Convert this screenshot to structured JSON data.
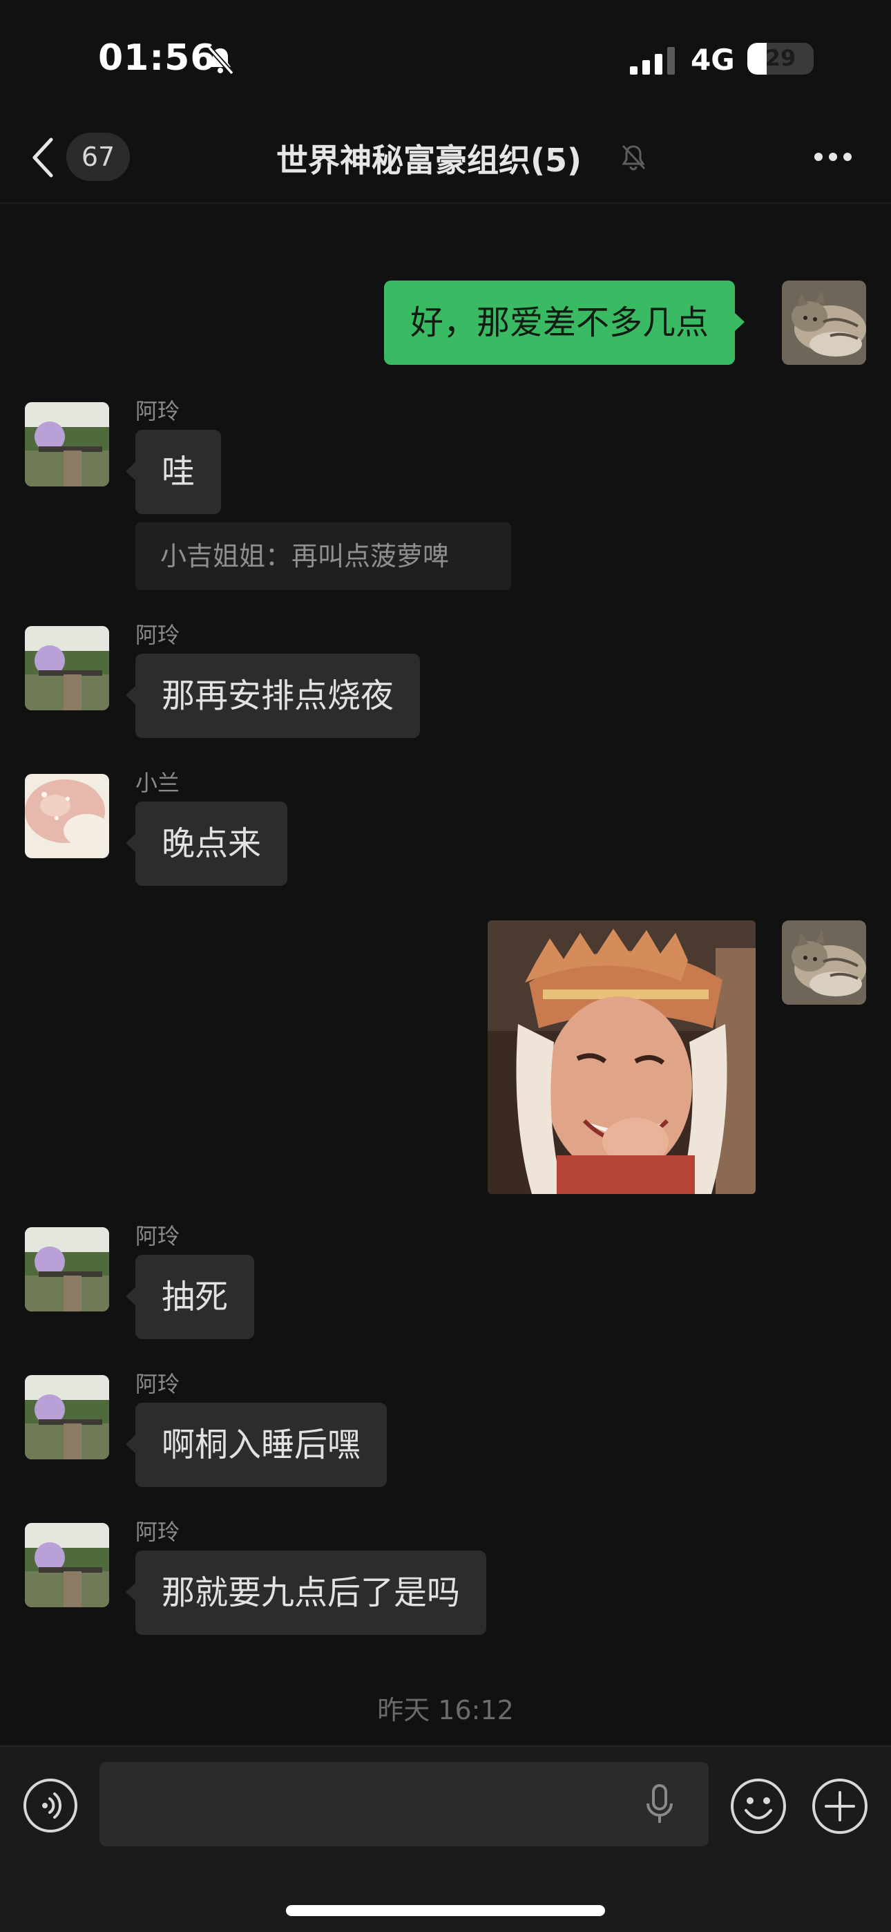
{
  "status_bar": {
    "time": "01:56",
    "network": "4G",
    "battery_level": "29",
    "battery_fraction": 0.29,
    "icons": [
      "bell-slash-icon",
      "signal-bars-icon",
      "battery-icon"
    ]
  },
  "header": {
    "unread_count": "67",
    "title": "世界神秘富豪组织(5)",
    "icons": [
      "chevron-left-icon",
      "bell-slash-icon",
      "more-dots-icon"
    ]
  },
  "messages": [
    {
      "kind": "text",
      "direction": "out",
      "text": "好，那爱差不多几点",
      "avatar": "cat-avatar"
    },
    {
      "kind": "text",
      "direction": "in",
      "sender": "阿玲",
      "text": "哇",
      "avatar": "park-balloon-avatar"
    },
    {
      "kind": "quote",
      "text": "小吉姐姐：再叫点菠萝啤"
    },
    {
      "kind": "text",
      "direction": "in",
      "sender": "阿玲",
      "text": "那再安排点烧夜",
      "avatar": "park-balloon-avatar"
    },
    {
      "kind": "text",
      "direction": "in",
      "sender": "小兰",
      "text": "晚点来",
      "avatar": "pink-floral-avatar"
    },
    {
      "kind": "image",
      "direction": "out",
      "description_icon": "sticker-image",
      "avatar": "cat-avatar"
    },
    {
      "kind": "text",
      "direction": "in",
      "sender": "阿玲",
      "text": "抽死",
      "avatar": "park-balloon-avatar"
    },
    {
      "kind": "text",
      "direction": "in",
      "sender": "阿玲",
      "text": "啊桐入睡后嘿",
      "avatar": "park-balloon-avatar"
    },
    {
      "kind": "text",
      "direction": "in",
      "sender": "阿玲",
      "text": "那就要九点后了是吗",
      "avatar": "park-balloon-avatar"
    }
  ],
  "timestamp": "昨天 16:12",
  "input_bar": {
    "value": "",
    "icons": [
      "voice-icon",
      "mic-icon",
      "emoji-icon",
      "plus-icon"
    ]
  },
  "colors": {
    "background": "#111111",
    "outgoing_bubble": "#3aba63",
    "incoming_bubble": "#2c2c2c",
    "input_bar": "#1b1b1b"
  }
}
